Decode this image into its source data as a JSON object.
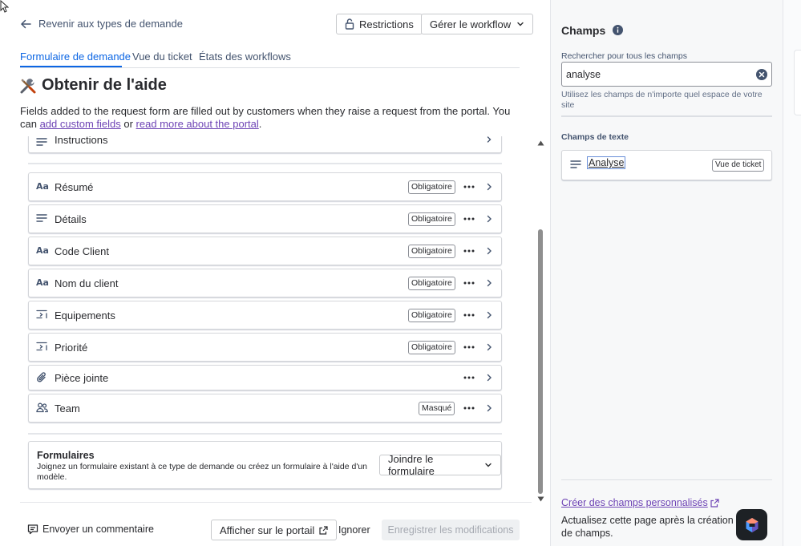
{
  "header": {
    "back_label": "Revenir aux types de demande",
    "restrictions_label": "Restrictions",
    "workflow_label": "Gérer le workflow"
  },
  "tabs": [
    {
      "label": "Formulaire de demande",
      "active": true
    },
    {
      "label": "Vue du ticket",
      "active": false
    },
    {
      "label": "États des workflows",
      "active": false
    }
  ],
  "page": {
    "title": "Obtenir de l'aide",
    "description_text": "Fields added to the request form are filled out by customers when they raise a request from the portal. You can ",
    "link_custom_fields": "add custom fields",
    "description_or": " or ",
    "link_portal": "read more about the portal",
    "description_end": "."
  },
  "fields": {
    "instructions_label": "Instructions",
    "rows": [
      {
        "icon": "short-text-icon",
        "label": "Résumé",
        "badge": "Obligatoire"
      },
      {
        "icon": "paragraph-icon",
        "label": "Détails",
        "badge": "Obligatoire"
      },
      {
        "icon": "short-text-icon",
        "label": "Code Client",
        "badge": "Obligatoire"
      },
      {
        "icon": "short-text-icon",
        "label": "Nom du client",
        "badge": "Obligatoire"
      },
      {
        "icon": "select-list-icon",
        "label": "Equipements",
        "badge": "Obligatoire"
      },
      {
        "icon": "select-list-icon",
        "label": "Priorité",
        "badge": "Obligatoire"
      },
      {
        "icon": "attachment-icon",
        "label": "Pièce jointe",
        "badge": ""
      },
      {
        "icon": "people-icon",
        "label": "Team",
        "badge": "Masqué"
      }
    ]
  },
  "forms_card": {
    "title": "Formulaires",
    "description": "Joignez un formulaire existant à ce type de demande ou créez un formulaire à l'aide d'un modèle.",
    "join_label": "Joindre le formulaire"
  },
  "footer": {
    "feedback_label": "Envoyer un commentaire",
    "portal_label": "Afficher sur le portail",
    "ignore_label": "Ignorer",
    "save_label": "Enregistrer les modifications"
  },
  "right_panel": {
    "title": "Champs",
    "search_label": "Rechercher pour tous les champs",
    "search_value": "analyse",
    "search_hint": "Utilisez les champs de n'importe quel espace de votre site",
    "section_title": "Champs de texte",
    "result_label": "Analyse",
    "result_badge": "Vue de ticket",
    "create_link": "Créer des champs personnalisés",
    "refresh_text": "Actualisez cette page après la création de champs."
  },
  "colors": {
    "accent": "#0c66e4",
    "link": "#6e44b5",
    "panel_bg": "#f7f8f9",
    "border": "#d4d6da"
  }
}
